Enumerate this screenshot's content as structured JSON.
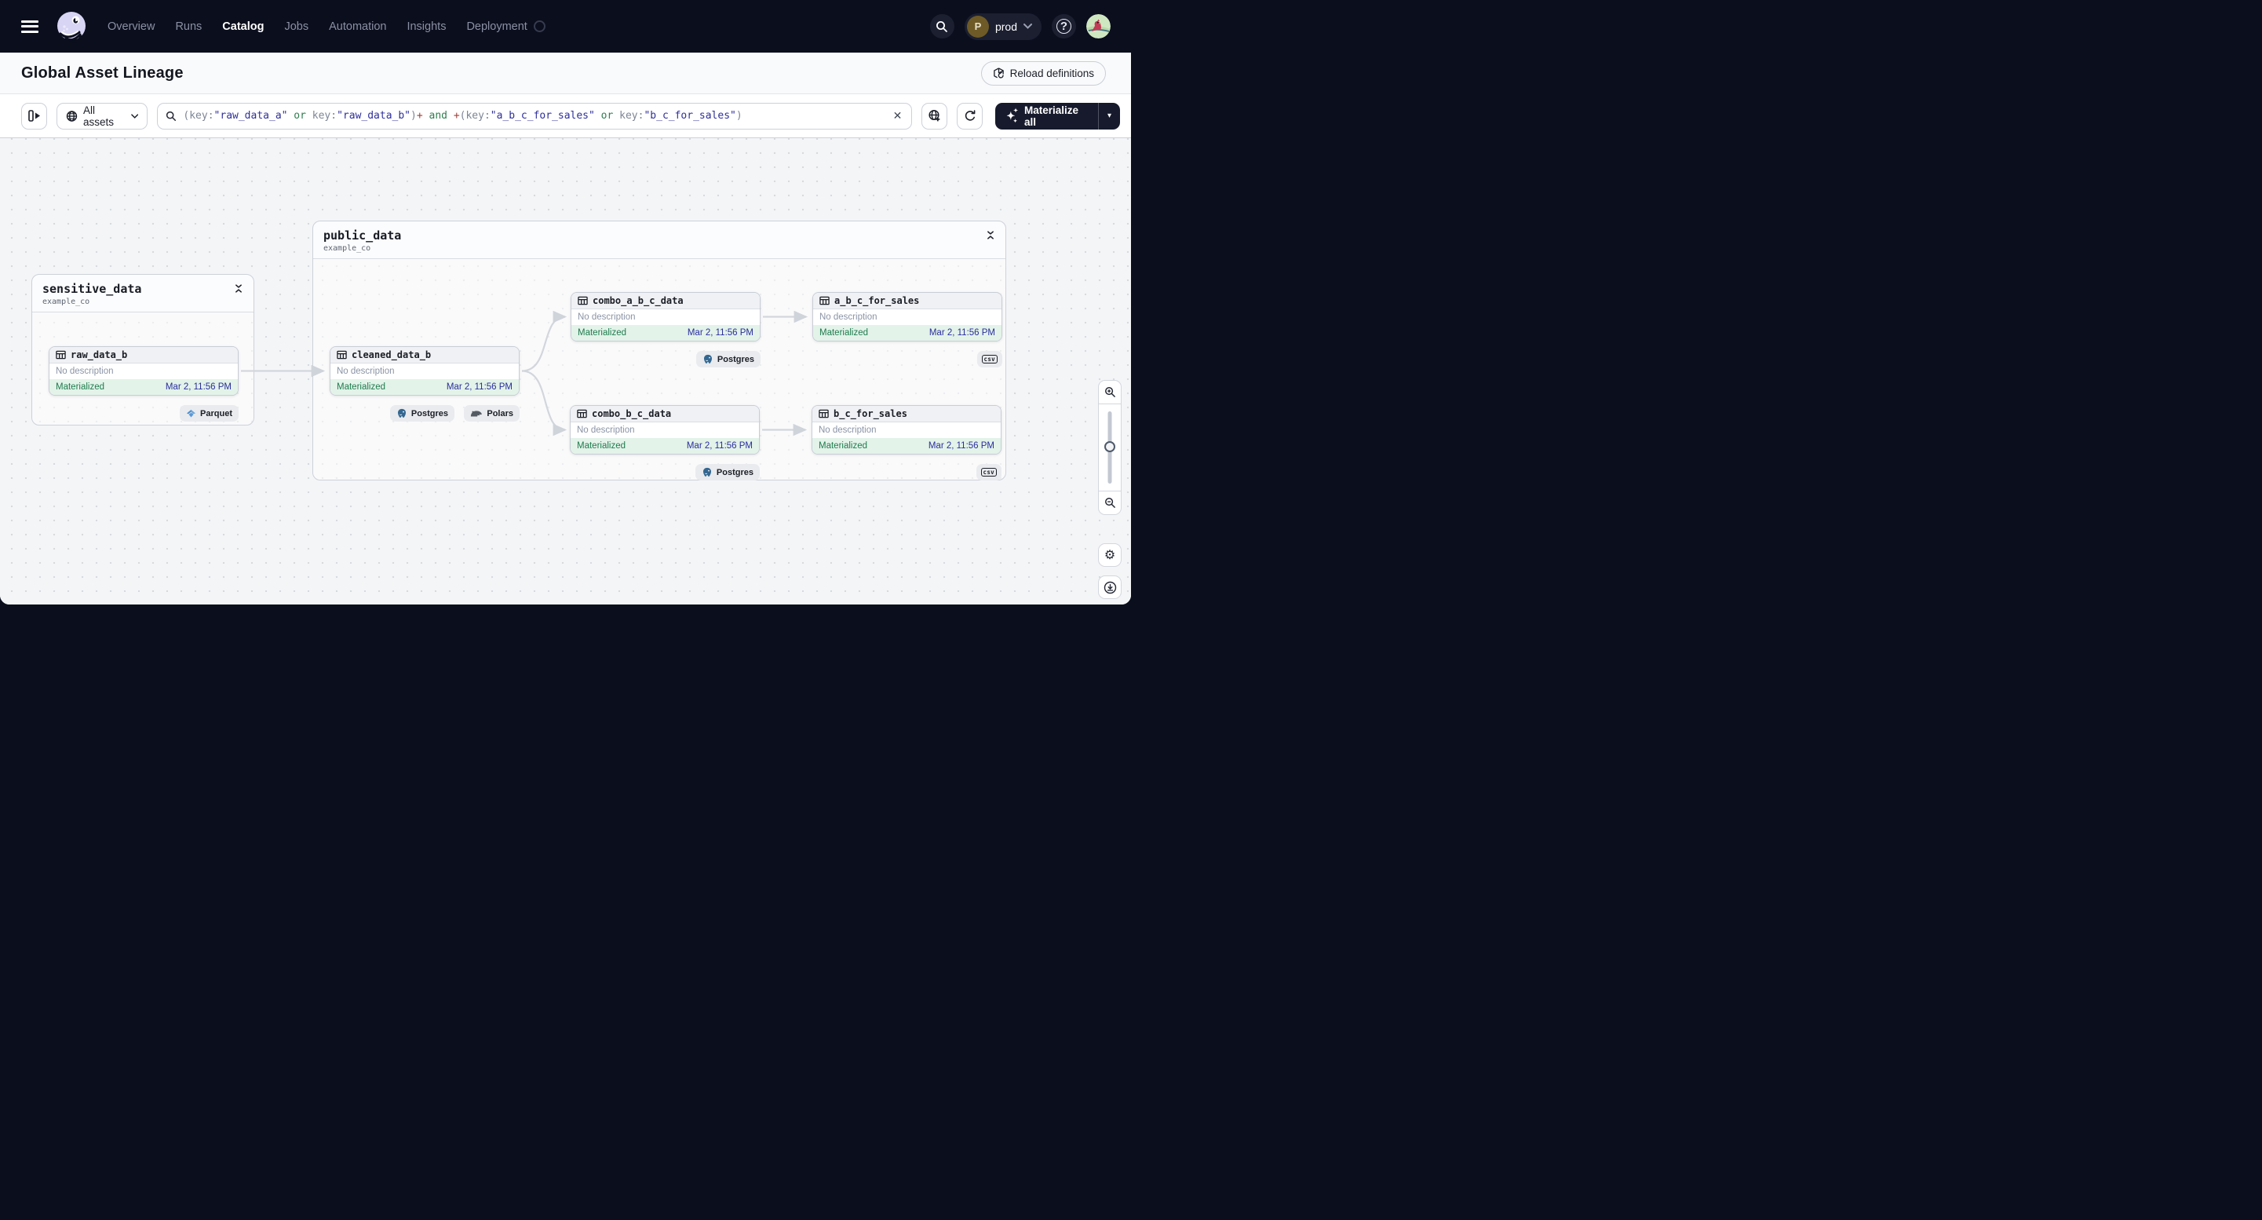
{
  "nav": {
    "items": [
      {
        "label": "Overview"
      },
      {
        "label": "Runs"
      },
      {
        "label": "Catalog"
      },
      {
        "label": "Jobs"
      },
      {
        "label": "Automation"
      },
      {
        "label": "Insights"
      },
      {
        "label": "Deployment"
      }
    ],
    "environment": {
      "initial": "P",
      "name": "prod"
    },
    "help_glyph": "?"
  },
  "header": {
    "title": "Global Asset Lineage",
    "reload_label": "Reload definitions"
  },
  "filterbar": {
    "assets_filter_label": "All assets",
    "materialize_label": "Materialize all",
    "clear_glyph": "✕",
    "caret_glyph": "▾",
    "query_tokens": [
      {
        "t": "(key:",
        "c": "punct"
      },
      {
        "t": "\"raw_data_a\"",
        "c": "str"
      },
      {
        "t": " or ",
        "c": "op"
      },
      {
        "t": "key:",
        "c": "punct"
      },
      {
        "t": "\"raw_data_b\"",
        "c": "str"
      },
      {
        "t": ")",
        "c": "punct"
      },
      {
        "t": "+",
        "c": "plus"
      },
      {
        "t": " and ",
        "c": "op"
      },
      {
        "t": "+",
        "c": "plus"
      },
      {
        "t": "(key:",
        "c": "punct"
      },
      {
        "t": "\"a_b_c_for_sales\"",
        "c": "str"
      },
      {
        "t": " or ",
        "c": "op"
      },
      {
        "t": "key:",
        "c": "punct"
      },
      {
        "t": "\"b_c_for_sales\"",
        "c": "str"
      },
      {
        "t": ")",
        "c": "punct"
      }
    ]
  },
  "graph": {
    "groups": [
      {
        "title": "sensitive_data",
        "subtitle": "example_co"
      },
      {
        "title": "public_data",
        "subtitle": "example_co"
      }
    ],
    "nodes": [
      {
        "name": "raw_data_b",
        "description": "No description",
        "status": "Materialized",
        "timestamp": "Mar 2, 11:56 PM",
        "tags": [
          "Parquet"
        ]
      },
      {
        "name": "cleaned_data_b",
        "description": "No description",
        "status": "Materialized",
        "timestamp": "Mar 2, 11:56 PM",
        "tags": [
          "Postgres",
          "Polars"
        ]
      },
      {
        "name": "combo_a_b_c_data",
        "description": "No description",
        "status": "Materialized",
        "timestamp": "Mar 2, 11:56 PM",
        "tags": [
          "Postgres"
        ]
      },
      {
        "name": "a_b_c_for_sales",
        "description": "No description",
        "status": "Materialized",
        "timestamp": "Mar 2, 11:56 PM",
        "tags": [
          "csv"
        ]
      },
      {
        "name": "combo_b_c_data",
        "description": "No description",
        "status": "Materialized",
        "timestamp": "Mar 2, 11:56 PM",
        "tags": [
          "Postgres"
        ]
      },
      {
        "name": "b_c_for_sales",
        "description": "No description",
        "status": "Materialized",
        "timestamp": "Mar 2, 11:56 PM",
        "tags": [
          "csv"
        ]
      }
    ],
    "tag_labels": {
      "parquet": "Parquet",
      "postgres": "Postgres",
      "polars": "Polars",
      "csv": "csv"
    },
    "edges": [
      {
        "from": "raw_data_b",
        "to": "cleaned_data_b"
      },
      {
        "from": "cleaned_data_b",
        "to": "combo_a_b_c_data"
      },
      {
        "from": "cleaned_data_b",
        "to": "combo_b_c_data"
      },
      {
        "from": "combo_a_b_c_data",
        "to": "a_b_c_for_sales"
      },
      {
        "from": "combo_b_c_data",
        "to": "b_c_for_sales"
      }
    ]
  },
  "controls": {
    "gear_glyph": "⚙"
  },
  "colors": {
    "navbar_bg": "#0b0e1d",
    "status_green_text": "#1e7b4d",
    "status_green_bg": "#e3f3e9",
    "timestamp_navy": "#2a2e9d",
    "query_string": "#2f2f9d",
    "query_operator": "#2f7d4f",
    "query_plus": "#9e4037",
    "edge_gray": "#d2d6dd"
  }
}
